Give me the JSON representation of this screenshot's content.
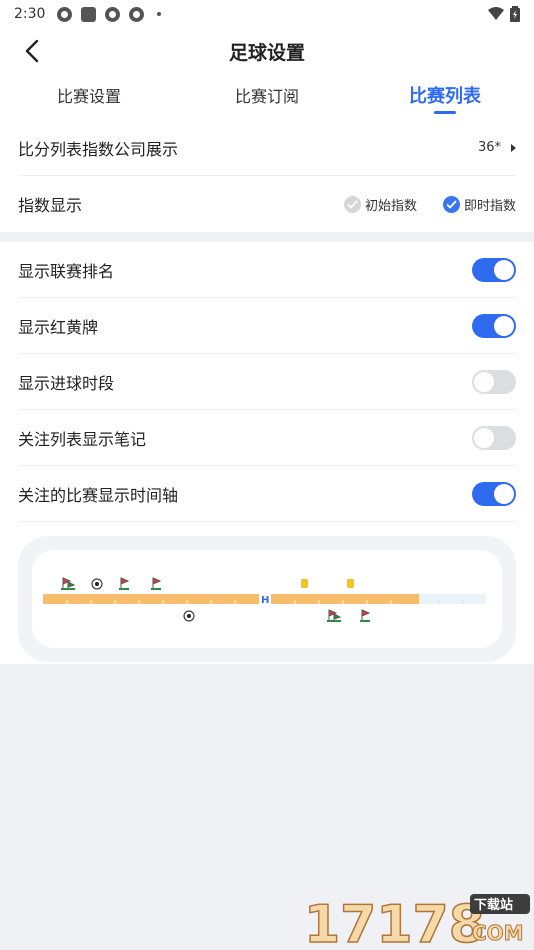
{
  "status": {
    "time": "2:30"
  },
  "header": {
    "title": "足球设置"
  },
  "tabs": [
    {
      "label": "比赛设置"
    },
    {
      "label": "比赛订阅"
    },
    {
      "label": "比赛列表"
    }
  ],
  "index_company": {
    "label": "比分列表指数公司展示",
    "value": "36*"
  },
  "index_display": {
    "label": "指数显示",
    "options": [
      {
        "label": "初始指数",
        "checked": false
      },
      {
        "label": "即时指数",
        "checked": true
      }
    ]
  },
  "toggles": [
    {
      "label": "显示联赛排名",
      "on": true
    },
    {
      "label": "显示红黄牌",
      "on": true
    },
    {
      "label": "显示进球时段",
      "on": false
    },
    {
      "label": "关注列表显示笔记",
      "on": false
    },
    {
      "label": "关注的比赛显示时间轴",
      "on": true
    }
  ],
  "timeline": {
    "half_marker": "H"
  },
  "watermark": {
    "text": "17178",
    "badge": "下载站",
    "domain": "COM"
  },
  "colors": {
    "accent": "#2f6bf0",
    "timeline_bar": "#f8bd6b",
    "timeline_rest": "#e9f3f8"
  }
}
